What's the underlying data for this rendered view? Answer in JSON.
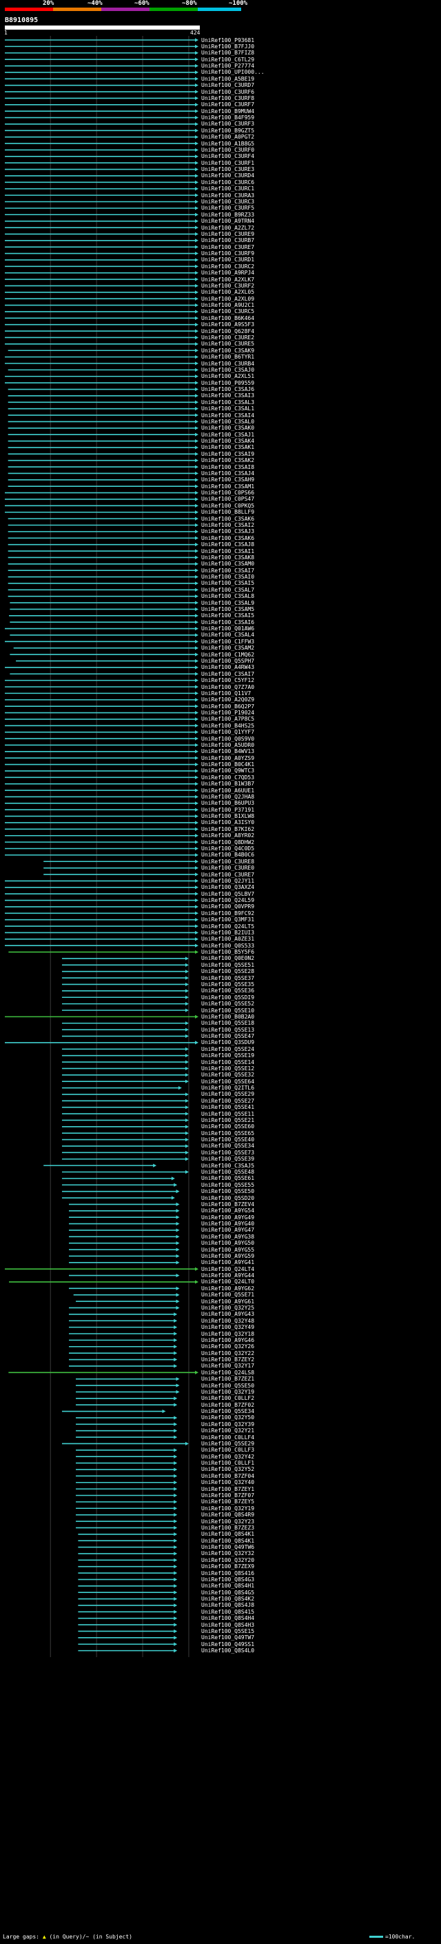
{
  "header": {
    "percent_labels": [
      "20%",
      "~40%",
      "~60%",
      "~80%",
      "~100%"
    ],
    "scale_colors": [
      "#ff0000",
      "#e87800",
      "#a020a0",
      "#00a000",
      "#00c0e0"
    ],
    "query_id": "B8910895",
    "ruler_start": "1",
    "ruler_end": "424"
  },
  "footer": {
    "large_gaps_text": "Large gaps:",
    "gap_legend": "(in Query)/~ (in Subject)",
    "scale_legend": "=100char."
  },
  "colors": {
    "background": "#000000",
    "hit_line": "#40d0d0",
    "alt_line": "#40c040",
    "gridline": "#3a3a3a"
  },
  "hits": [
    {
      "acc": "UniRef100_P93681",
      "s": 1,
      "e": 421
    },
    {
      "acc": "UniRef100_B7FJJ0",
      "s": 1,
      "e": 421
    },
    {
      "acc": "UniRef100_B7FIZ8",
      "s": 1,
      "e": 421
    },
    {
      "acc": "UniRef100_C6TL29",
      "s": 1,
      "e": 421
    },
    {
      "acc": "UniRef100_P27774",
      "s": 1,
      "e": 421
    },
    {
      "acc": "UniRef100_UPI000...",
      "s": 1,
      "e": 421
    },
    {
      "acc": "UniRef100_A5BE19",
      "s": 1,
      "e": 421
    },
    {
      "acc": "UniRef100_C3URD7",
      "s": 1,
      "e": 421
    },
    {
      "acc": "UniRef100_C3URF6",
      "s": 1,
      "e": 421
    },
    {
      "acc": "UniRef100_C3URF8",
      "s": 1,
      "e": 421
    },
    {
      "acc": "UniRef100_C3URF7",
      "s": 1,
      "e": 421
    },
    {
      "acc": "UniRef100_B9MUW4",
      "s": 1,
      "e": 421
    },
    {
      "acc": "UniRef100_B4F959",
      "s": 1,
      "e": 421
    },
    {
      "acc": "UniRef100_C3URF3",
      "s": 1,
      "e": 421
    },
    {
      "acc": "UniRef100_B9GZT5",
      "s": 1,
      "e": 421
    },
    {
      "acc": "UniRef100_A0PGT2",
      "s": 1,
      "e": 421
    },
    {
      "acc": "UniRef100_A1B8G5",
      "s": 1,
      "e": 421
    },
    {
      "acc": "UniRef100_C3URF0",
      "s": 1,
      "e": 421
    },
    {
      "acc": "UniRef100_C3URF4",
      "s": 1,
      "e": 421
    },
    {
      "acc": "UniRef100_C3URF1",
      "s": 1,
      "e": 421
    },
    {
      "acc": "UniRef100_C3URE3",
      "s": 1,
      "e": 421
    },
    {
      "acc": "UniRef100_C3URD4",
      "s": 1,
      "e": 421
    },
    {
      "acc": "UniRef100_C3URC6",
      "s": 1,
      "e": 421
    },
    {
      "acc": "UniRef100_C3URC1",
      "s": 1,
      "e": 421
    },
    {
      "acc": "UniRef100_C3URA3",
      "s": 1,
      "e": 421
    },
    {
      "acc": "UniRef100_C3URC3",
      "s": 1,
      "e": 421
    },
    {
      "acc": "UniRef100_C3URF5",
      "s": 1,
      "e": 421
    },
    {
      "acc": "UniRef100_B9RZ33",
      "s": 1,
      "e": 421
    },
    {
      "acc": "UniRef100_A9TRN4",
      "s": 1,
      "e": 421
    },
    {
      "acc": "UniRef100_A2ZL72",
      "s": 1,
      "e": 421
    },
    {
      "acc": "UniRef100_C3URE9",
      "s": 1,
      "e": 421
    },
    {
      "acc": "UniRef100_C3URB7",
      "s": 1,
      "e": 421
    },
    {
      "acc": "UniRef100_C3URE7",
      "s": 1,
      "e": 421
    },
    {
      "acc": "UniRef100_C3URF9",
      "s": 1,
      "e": 421
    },
    {
      "acc": "UniRef100_C3URD1",
      "s": 1,
      "e": 421
    },
    {
      "acc": "UniRef100_C3URC2",
      "s": 1,
      "e": 421
    },
    {
      "acc": "UniRef100_A9RPJ4",
      "s": 1,
      "e": 421
    },
    {
      "acc": "UniRef100_A2XLK7",
      "s": 1,
      "e": 421
    },
    {
      "acc": "UniRef100_C3URF2",
      "s": 1,
      "e": 421
    },
    {
      "acc": "UniRef100_A2XL05",
      "s": 1,
      "e": 421
    },
    {
      "acc": "UniRef100_A2XL09",
      "s": 1,
      "e": 421
    },
    {
      "acc": "UniRef100_A9U2C1",
      "s": 1,
      "e": 421
    },
    {
      "acc": "UniRef100_C3URC5",
      "s": 1,
      "e": 421
    },
    {
      "acc": "UniRef100_B6K464",
      "s": 1,
      "e": 421
    },
    {
      "acc": "UniRef100_A9S5F3",
      "s": 1,
      "e": 421
    },
    {
      "acc": "UniRef100_Q628F4",
      "s": 1,
      "e": 421
    },
    {
      "acc": "UniRef100_C3URE2",
      "s": 1,
      "e": 421
    },
    {
      "acc": "UniRef100_C3URE5",
      "s": 1,
      "e": 421
    },
    {
      "acc": "UniRef100_C3SAK9",
      "s": 8,
      "e": 421
    },
    {
      "acc": "UniRef100_B6TYR1",
      "s": 1,
      "e": 421
    },
    {
      "acc": "UniRef100_C3URB4",
      "s": 1,
      "e": 421
    },
    {
      "acc": "UniRef100_C3SAJ0",
      "s": 8,
      "e": 421
    },
    {
      "acc": "UniRef100_A2XL51",
      "s": 1,
      "e": 421
    },
    {
      "acc": "UniRef100_P09559",
      "s": 1,
      "e": 421
    },
    {
      "acc": "UniRef100_C3SAJ6",
      "s": 8,
      "e": 421
    },
    {
      "acc": "UniRef100_C3SAI3",
      "s": 8,
      "e": 421
    },
    {
      "acc": "UniRef100_C3SAL3",
      "s": 8,
      "e": 421
    },
    {
      "acc": "UniRef100_C3SAL1",
      "s": 8,
      "e": 421
    },
    {
      "acc": "UniRef100_C3SAI4",
      "s": 8,
      "e": 421
    },
    {
      "acc": "UniRef100_C3SAL0",
      "s": 8,
      "e": 421
    },
    {
      "acc": "UniRef100_C3SAK0",
      "s": 8,
      "e": 421
    },
    {
      "acc": "UniRef100_C3SAJ1",
      "s": 8,
      "e": 421
    },
    {
      "acc": "UniRef100_C3SAK4",
      "s": 8,
      "e": 421
    },
    {
      "acc": "UniRef100_C3SAK1",
      "s": 8,
      "e": 421
    },
    {
      "acc": "UniRef100_C3SAI9",
      "s": 8,
      "e": 421
    },
    {
      "acc": "UniRef100_C3SAK2",
      "s": 8,
      "e": 421
    },
    {
      "acc": "UniRef100_C3SAI8",
      "s": 8,
      "e": 421
    },
    {
      "acc": "UniRef100_C3SAJ4",
      "s": 8,
      "e": 421
    },
    {
      "acc": "UniRef100_C3SAH9",
      "s": 8,
      "e": 421
    },
    {
      "acc": "UniRef100_C3SAM1",
      "s": 8,
      "e": 421
    },
    {
      "acc": "UniRef100_C0PS66",
      "s": 1,
      "e": 421
    },
    {
      "acc": "UniRef100_C0PS47",
      "s": 1,
      "e": 421
    },
    {
      "acc": "UniRef100_C0PKQ5",
      "s": 1,
      "e": 421
    },
    {
      "acc": "UniRef100_B8LLF9",
      "s": 1,
      "e": 421
    },
    {
      "acc": "UniRef100_C3SAK6",
      "s": 8,
      "e": 421
    },
    {
      "acc": "UniRef100_C3SAI2",
      "s": 8,
      "e": 421
    },
    {
      "acc": "UniRef100_C3SAJ3",
      "s": 8,
      "e": 421
    },
    {
      "acc": "UniRef100_C3SAK6",
      "s": 8,
      "e": 421
    },
    {
      "acc": "UniRef100_C3SAJ8",
      "s": 8,
      "e": 421
    },
    {
      "acc": "UniRef100_C3SAI1",
      "s": 8,
      "e": 421
    },
    {
      "acc": "UniRef100_C3SAK8",
      "s": 8,
      "e": 421
    },
    {
      "acc": "UniRef100_C3SAM0",
      "s": 8,
      "e": 421
    },
    {
      "acc": "UniRef100_C3SAI7",
      "s": 8,
      "e": 421
    },
    {
      "acc": "UniRef100_C3SAI0",
      "s": 8,
      "e": 421
    },
    {
      "acc": "UniRef100_C3SAI5",
      "s": 8,
      "e": 421
    },
    {
      "acc": "UniRef100_C3SAL7",
      "s": 8,
      "e": 421
    },
    {
      "acc": "UniRef100_C3SAL8",
      "s": 8,
      "e": 421
    },
    {
      "acc": "UniRef100_C3SAL9",
      "s": 12,
      "e": 421
    },
    {
      "acc": "UniRef100_C3SAM5",
      "s": 12,
      "e": 421
    },
    {
      "acc": "UniRef100_C3SAI5",
      "s": 10,
      "e": 421
    },
    {
      "acc": "UniRef100_C3SAI6",
      "s": 12,
      "e": 421
    },
    {
      "acc": "UniRef100_Q01AW6",
      "s": 1,
      "e": 421
    },
    {
      "acc": "UniRef100_C3SAL4",
      "s": 12,
      "e": 421
    },
    {
      "acc": "UniRef100_C1FFW3",
      "s": 1,
      "e": 421
    },
    {
      "acc": "UniRef100_C3SAM2",
      "s": 20,
      "e": 421
    },
    {
      "acc": "UniRef100_C1MQ62",
      "s": 12,
      "e": 421
    },
    {
      "acc": "UniRef100_Q5SPH7",
      "s": 25,
      "e": 421
    },
    {
      "acc": "UniRef100_A4RW43",
      "s": 1,
      "e": 421
    },
    {
      "acc": "UniRef100_C3SAI7",
      "s": 12,
      "e": 421
    },
    {
      "acc": "UniRef100_C5YF12",
      "s": 1,
      "e": 421
    },
    {
      "acc": "UniRef100_Q7Z7A0",
      "s": 1,
      "e": 421
    },
    {
      "acc": "UniRef100_Q11V7",
      "s": 1,
      "e": 421
    },
    {
      "acc": "UniRef100_A2Q0Z9",
      "s": 1,
      "e": 421
    },
    {
      "acc": "UniRef100_B6Q2P7",
      "s": 1,
      "e": 421
    },
    {
      "acc": "UniRef100_P19024",
      "s": 1,
      "e": 421
    },
    {
      "acc": "UniRef100_A7P8C5",
      "s": 1,
      "e": 421
    },
    {
      "acc": "UniRef100_B4HS25",
      "s": 1,
      "e": 421
    },
    {
      "acc": "UniRef100_Q1YYF7",
      "s": 1,
      "e": 421
    },
    {
      "acc": "UniRef100_Q0S9V0",
      "s": 1,
      "e": 421
    },
    {
      "acc": "UniRef100_A5UDR0",
      "s": 1,
      "e": 421
    },
    {
      "acc": "UniRef100_B4WV13",
      "s": 1,
      "e": 421
    },
    {
      "acc": "UniRef100_A0YZS9",
      "s": 1,
      "e": 421
    },
    {
      "acc": "UniRef100_B0C4K1",
      "s": 1,
      "e": 421
    },
    {
      "acc": "UniRef100_Q9WTC3",
      "s": 1,
      "e": 421
    },
    {
      "acc": "UniRef100_C7QD53",
      "s": 1,
      "e": 421
    },
    {
      "acc": "UniRef100_B1W3B7",
      "s": 1,
      "e": 421
    },
    {
      "acc": "UniRef100_A6UUE1",
      "s": 1,
      "e": 421
    },
    {
      "acc": "UniRef100_Q2JHA8",
      "s": 1,
      "e": 421
    },
    {
      "acc": "UniRef100_B6UPU3",
      "s": 1,
      "e": 421
    },
    {
      "acc": "UniRef100_P37191",
      "s": 1,
      "e": 421
    },
    {
      "acc": "UniRef100_B1XLW8",
      "s": 1,
      "e": 421
    },
    {
      "acc": "UniRef100_A3ISY0",
      "s": 1,
      "e": 421
    },
    {
      "acc": "UniRef100_B7KI62",
      "s": 1,
      "e": 421
    },
    {
      "acc": "UniRef100_A8YR02",
      "s": 1,
      "e": 421
    },
    {
      "acc": "UniRef100_Q8DHW2",
      "s": 1,
      "e": 421
    },
    {
      "acc": "UniRef100_Q4C0D5",
      "s": 1,
      "e": 421
    },
    {
      "acc": "UniRef100_B4B0C6",
      "s": 1,
      "e": 421
    },
    {
      "acc": "UniRef100_C3URE8",
      "s": 85,
      "e": 421
    },
    {
      "acc": "UniRef100_C3URE0",
      "s": 85,
      "e": 421
    },
    {
      "acc": "UniRef100_C3URE7",
      "s": 85,
      "e": 421
    },
    {
      "acc": "UniRef100_Q2JY11",
      "s": 1,
      "e": 421
    },
    {
      "acc": "UniRef100_Q3AXZ4",
      "s": 1,
      "e": 421
    },
    {
      "acc": "UniRef100_Q5LBV7",
      "s": 1,
      "e": 421
    },
    {
      "acc": "UniRef100_Q24L59",
      "s": 1,
      "e": 421
    },
    {
      "acc": "UniRef100_Q0VPR9",
      "s": 1,
      "e": 421
    },
    {
      "acc": "UniRef100_B9FC92",
      "s": 1,
      "e": 421
    },
    {
      "acc": "UniRef100_Q3MF31",
      "s": 1,
      "e": 421
    },
    {
      "acc": "UniRef100_Q24LT5",
      "s": 1,
      "e": 421
    },
    {
      "acc": "UniRef100_B2IUI3",
      "s": 1,
      "e": 421
    },
    {
      "acc": "UniRef100_A0ZE31",
      "s": 1,
      "e": 421
    },
    {
      "acc": "UniRef100_Q0S533",
      "s": 1,
      "e": 421
    },
    {
      "acc": "UniRef100_B5Y5F6",
      "s": 9,
      "e": 421,
      "alt": true
    },
    {
      "acc": "UniRef100_Q0E0N2",
      "s": 125,
      "e": 400
    },
    {
      "acc": "UniRef100_Q5SE51",
      "s": 125,
      "e": 400
    },
    {
      "acc": "UniRef100_Q5SE28",
      "s": 125,
      "e": 400
    },
    {
      "acc": "UniRef100_Q5SE37",
      "s": 125,
      "e": 400
    },
    {
      "acc": "UniRef100_Q5SE35",
      "s": 125,
      "e": 400
    },
    {
      "acc": "UniRef100_Q5SE36",
      "s": 125,
      "e": 400
    },
    {
      "acc": "UniRef100_Q5SDI9",
      "s": 125,
      "e": 400
    },
    {
      "acc": "UniRef100_Q5SE52",
      "s": 125,
      "e": 400
    },
    {
      "acc": "UniRef100_Q5SE10",
      "s": 125,
      "e": 400
    },
    {
      "acc": "UniRef100_B0B2A0",
      "s": 1,
      "e": 421,
      "alt": true
    },
    {
      "acc": "UniRef100_Q5SE18",
      "s": 125,
      "e": 400
    },
    {
      "acc": "UniRef100_Q5SE13",
      "s": 125,
      "e": 400
    },
    {
      "acc": "UniRef100_Q5SE47",
      "s": 125,
      "e": 400
    },
    {
      "acc": "UniRef100_Q3SDU9",
      "s": 1,
      "e": 421
    },
    {
      "acc": "UniRef100_Q5SE24",
      "s": 125,
      "e": 400
    },
    {
      "acc": "UniRef100_Q5SE19",
      "s": 125,
      "e": 400
    },
    {
      "acc": "UniRef100_Q5SE14",
      "s": 125,
      "e": 400
    },
    {
      "acc": "UniRef100_Q5SE12",
      "s": 125,
      "e": 400
    },
    {
      "acc": "UniRef100_Q5SE32",
      "s": 125,
      "e": 400
    },
    {
      "acc": "UniRef100_Q5SE64",
      "s": 125,
      "e": 400
    },
    {
      "acc": "UniRef100_Q2ITL6",
      "s": 125,
      "e": 385
    },
    {
      "acc": "UniRef100_Q5SE29",
      "s": 125,
      "e": 400
    },
    {
      "acc": "UniRef100_Q5SE27",
      "s": 125,
      "e": 400
    },
    {
      "acc": "UniRef100_Q5SE41",
      "s": 125,
      "e": 400
    },
    {
      "acc": "UniRef100_Q5SE11",
      "s": 125,
      "e": 400
    },
    {
      "acc": "UniRef100_Q5SE21",
      "s": 125,
      "e": 400
    },
    {
      "acc": "UniRef100_Q5SE60",
      "s": 125,
      "e": 400
    },
    {
      "acc": "UniRef100_Q5SE65",
      "s": 125,
      "e": 400
    },
    {
      "acc": "UniRef100_Q5SE40",
      "s": 125,
      "e": 400
    },
    {
      "acc": "UniRef100_Q5SE34",
      "s": 125,
      "e": 400
    },
    {
      "acc": "UniRef100_Q5SE73",
      "s": 125,
      "e": 400
    },
    {
      "acc": "UniRef100_Q5SE39",
      "s": 125,
      "e": 400
    },
    {
      "acc": "UniRef100_C3SAJ5",
      "s": 85,
      "e": 330
    },
    {
      "acc": "UniRef100_Q5SE48",
      "s": 125,
      "e": 400
    },
    {
      "acc": "UniRef100_Q5SE61",
      "s": 125,
      "e": 370
    },
    {
      "acc": "UniRef100_Q5SE55",
      "s": 125,
      "e": 375
    },
    {
      "acc": "UniRef100_Q5SE50",
      "s": 125,
      "e": 380
    },
    {
      "acc": "UniRef100_Q5SD20",
      "s": 125,
      "e": 370
    },
    {
      "acc": "UniRef100_B7ZEV4",
      "s": 140,
      "e": 380
    },
    {
      "acc": "UniRef100_A9YG54",
      "s": 140,
      "e": 380
    },
    {
      "acc": "UniRef100_A9YG49",
      "s": 140,
      "e": 380
    },
    {
      "acc": "UniRef100_A9YG40",
      "s": 140,
      "e": 380
    },
    {
      "acc": "UniRef100_A9YG47",
      "s": 140,
      "e": 380
    },
    {
      "acc": "UniRef100_A9YG38",
      "s": 140,
      "e": 380
    },
    {
      "acc": "UniRef100_A9YG50",
      "s": 140,
      "e": 380
    },
    {
      "acc": "UniRef100_A9YG55",
      "s": 140,
      "e": 380
    },
    {
      "acc": "UniRef100_A9YG59",
      "s": 140,
      "e": 380
    },
    {
      "acc": "UniRef100_A9YG41",
      "s": 140,
      "e": 380
    },
    {
      "acc": "UniRef100_Q24LT4",
      "s": 1,
      "e": 421,
      "alt": true
    },
    {
      "acc": "UniRef100_A9YG44",
      "s": 140,
      "e": 380
    },
    {
      "acc": "UniRef100_Q24LT0",
      "s": 10,
      "e": 421,
      "alt": true
    },
    {
      "acc": "UniRef100_A9YG62",
      "s": 140,
      "e": 380
    },
    {
      "acc": "UniRef100_Q5SE71",
      "s": 150,
      "e": 380
    },
    {
      "acc": "UniRef100_A9YG61",
      "s": 155,
      "e": 380
    },
    {
      "acc": "UniRef100_Q32Y25",
      "s": 140,
      "e": 380
    },
    {
      "acc": "UniRef100_A9YG43",
      "s": 140,
      "e": 375
    },
    {
      "acc": "UniRef100_Q32Y48",
      "s": 140,
      "e": 375
    },
    {
      "acc": "UniRef100_Q32Y49",
      "s": 140,
      "e": 375
    },
    {
      "acc": "UniRef100_Q32Y18",
      "s": 140,
      "e": 375
    },
    {
      "acc": "UniRef100_A9YG46",
      "s": 140,
      "e": 375
    },
    {
      "acc": "UniRef100_Q32Y26",
      "s": 140,
      "e": 375
    },
    {
      "acc": "UniRef100_Q32Y22",
      "s": 140,
      "e": 375
    },
    {
      "acc": "UniRef100_B7ZEY2",
      "s": 140,
      "e": 375
    },
    {
      "acc": "UniRef100_Q32Y17",
      "s": 140,
      "e": 375
    },
    {
      "acc": "UniRef100_Q24LS8",
      "s": 9,
      "e": 421,
      "alt": true
    },
    {
      "acc": "UniRef100_B7ZEZ1",
      "s": 155,
      "e": 380
    },
    {
      "acc": "UniRef100_Q5SE50",
      "s": 155,
      "e": 380
    },
    {
      "acc": "UniRef100_Q32Y19",
      "s": 155,
      "e": 380
    },
    {
      "acc": "UniRef100_C0LLF2",
      "s": 155,
      "e": 375
    },
    {
      "acc": "UniRef100_B7ZF02",
      "s": 155,
      "e": 375
    },
    {
      "acc": "UniRef100_Q5SE34",
      "s": 125,
      "e": 350
    },
    {
      "acc": "UniRef100_Q32Y50",
      "s": 155,
      "e": 375
    },
    {
      "acc": "UniRef100_Q32Y39",
      "s": 155,
      "e": 375
    },
    {
      "acc": "UniRef100_Q32Y21",
      "s": 155,
      "e": 375
    },
    {
      "acc": "UniRef100_C0LLF4",
      "s": 155,
      "e": 375
    },
    {
      "acc": "UniRef100_Q5SE29",
      "s": 125,
      "e": 400
    },
    {
      "acc": "UniRef100_C0LLF3",
      "s": 155,
      "e": 375
    },
    {
      "acc": "UniRef100_Q32Y42",
      "s": 155,
      "e": 375
    },
    {
      "acc": "UniRef100_C0LLF1",
      "s": 155,
      "e": 375
    },
    {
      "acc": "UniRef100_Q32Y52",
      "s": 155,
      "e": 375
    },
    {
      "acc": "UniRef100_B7ZF04",
      "s": 155,
      "e": 375
    },
    {
      "acc": "UniRef100_Q32Y40",
      "s": 155,
      "e": 375
    },
    {
      "acc": "UniRef100_B7ZEY1",
      "s": 155,
      "e": 375
    },
    {
      "acc": "UniRef100_B7ZF07",
      "s": 155,
      "e": 375
    },
    {
      "acc": "UniRef100_B7ZEY5",
      "s": 155,
      "e": 375
    },
    {
      "acc": "UniRef100_Q32Y19",
      "s": 155,
      "e": 375
    },
    {
      "acc": "UniRef100_Q8S4R9",
      "s": 155,
      "e": 375
    },
    {
      "acc": "UniRef100_Q32Y23",
      "s": 155,
      "e": 375
    },
    {
      "acc": "UniRef100_B7ZEZ3",
      "s": 155,
      "e": 375
    },
    {
      "acc": "UniRef100_Q8S4K1",
      "s": 160,
      "e": 375
    },
    {
      "acc": "UniRef100_Q8S4K1",
      "s": 160,
      "e": 375
    },
    {
      "acc": "UniRef100_Q49TW6",
      "s": 160,
      "e": 375
    },
    {
      "acc": "UniRef100_Q32Y32",
      "s": 160,
      "e": 375
    },
    {
      "acc": "UniRef100_Q32Y20",
      "s": 160,
      "e": 375
    },
    {
      "acc": "UniRef100_B7ZEX9",
      "s": 160,
      "e": 375
    },
    {
      "acc": "UniRef100_Q8S416",
      "s": 160,
      "e": 375
    },
    {
      "acc": "UniRef100_Q8S4G3",
      "s": 160,
      "e": 375
    },
    {
      "acc": "UniRef100_Q8S4H1",
      "s": 160,
      "e": 375
    },
    {
      "acc": "UniRef100_Q8S4G5",
      "s": 160,
      "e": 375
    },
    {
      "acc": "UniRef100_Q8S4K2",
      "s": 160,
      "e": 375
    },
    {
      "acc": "UniRef100_Q8S4J8",
      "s": 160,
      "e": 375
    },
    {
      "acc": "UniRef100_Q8S415",
      "s": 160,
      "e": 375
    },
    {
      "acc": "UniRef100_Q8S4H4",
      "s": 160,
      "e": 375
    },
    {
      "acc": "UniRef100_Q8S4H3",
      "s": 160,
      "e": 375
    },
    {
      "acc": "UniRef100_Q5SE15",
      "s": 160,
      "e": 375
    },
    {
      "acc": "UniRef100_Q49TW7",
      "s": 160,
      "e": 375
    },
    {
      "acc": "UniRef100_Q49SS1",
      "s": 160,
      "e": 375
    },
    {
      "acc": "UniRef100_Q8S4L0",
      "s": 160,
      "e": 375
    }
  ]
}
